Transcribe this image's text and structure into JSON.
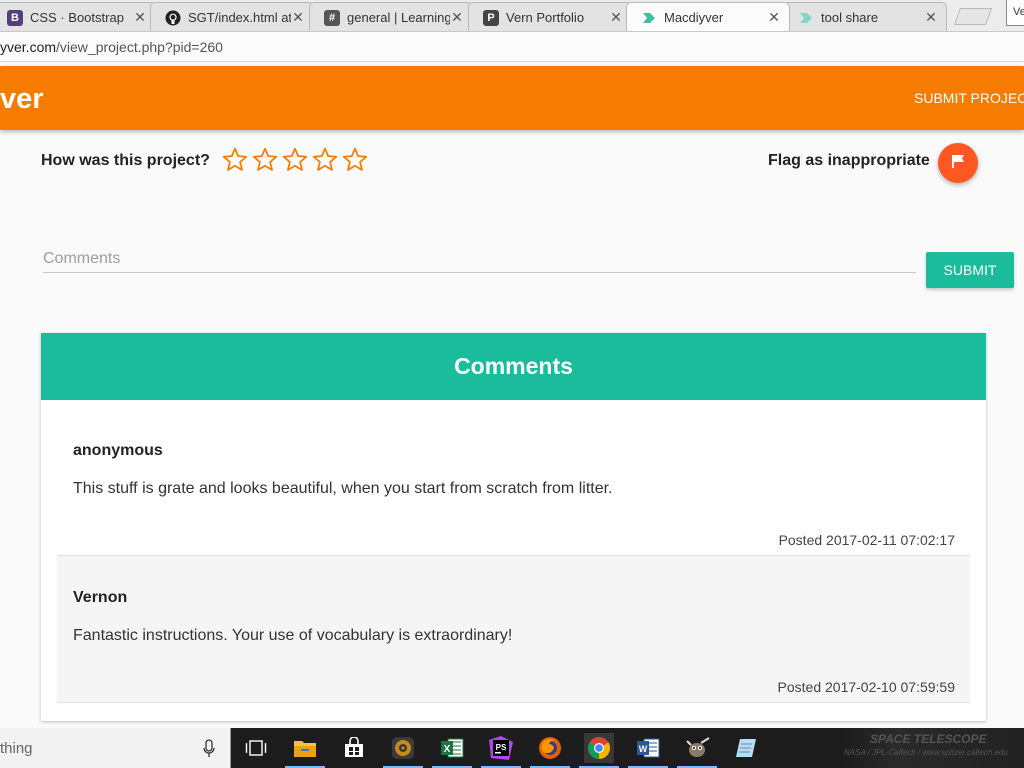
{
  "browser": {
    "tabs": [
      {
        "title": "CSS · Bootstrap",
        "icon": "bootstrap-icon",
        "color": "#563d7c",
        "glyph": "B",
        "active": false
      },
      {
        "title": "SGT/index.html at",
        "icon": "github-icon",
        "color": "#222222",
        "glyph": "",
        "active": false
      },
      {
        "title": "general | Learning",
        "icon": "slack-hash-icon",
        "color": "#555555",
        "glyph": "#",
        "active": false
      },
      {
        "title": "Vern Portfolio",
        "icon": "portfolio-icon",
        "color": "#444444",
        "glyph": "P",
        "active": false
      },
      {
        "title": "Macdiyver",
        "icon": "macdiyver-icon",
        "color": "#3fbf9f",
        "glyph": "",
        "active": true
      },
      {
        "title": "tool share",
        "icon": "toolshare-icon",
        "color": "#86d4c4",
        "glyph": "",
        "active": false
      }
    ],
    "close_glyph": "✕",
    "user_chip": "Ve",
    "url_host": "yver.com",
    "url_path": "/view_project.php?pid=260"
  },
  "header": {
    "brand": "ver",
    "nav_submit": "SUBMIT PROJEC",
    "color": "#f57c00"
  },
  "rating": {
    "label": "How was this project?",
    "stars": 5,
    "selected": 0,
    "star_color": "#f57c00"
  },
  "flag": {
    "label": "Flag as inappropriate",
    "color": "#ff5722"
  },
  "comment_form": {
    "placeholder": "Comments",
    "value": "",
    "submit_label": "SUBMIT",
    "button_color": "#1abc9c"
  },
  "comments": {
    "title": "Comments",
    "items": [
      {
        "author": "anonymous",
        "text": "This stuff is grate and looks beautiful, when you start from scratch from litter.",
        "posted": "Posted 2017-02-11 07:02:17"
      },
      {
        "author": "Vernon",
        "text": "Fantastic instructions. Your use of vocabulary is extraordinary!",
        "posted": "Posted 2017-02-10 07:59:59"
      }
    ]
  },
  "taskbar": {
    "search_placeholder": "thing",
    "apps": [
      "task-view-icon",
      "file-explorer-icon",
      "store-icon",
      "media-player-icon",
      "excel-icon",
      "phpstorm-icon",
      "firefox-icon",
      "chrome-icon",
      "word-icon",
      "gimp-icon",
      "notepad-icon"
    ],
    "tray_line1": "SPACE TELESCOPE",
    "tray_line2": "NASA / JPL-Caltech / www.spitzer.caltech.edu"
  }
}
